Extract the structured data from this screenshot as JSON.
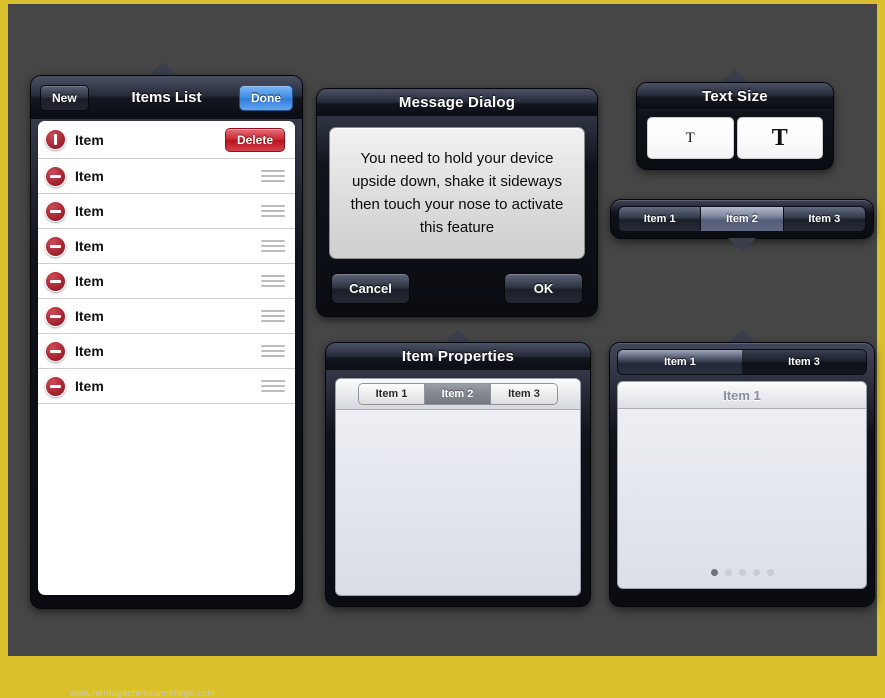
{
  "watermark": "www.heritagechristiancollege.com",
  "colors": {
    "frame": "#d9c02c",
    "canvas_bg": "#464646",
    "accent_blue": "#3f8de5",
    "delete_red": "#cd2430",
    "panel_dark": "#11131b"
  },
  "items_list": {
    "title": "Items List",
    "new_label": "New",
    "done_label": "Done",
    "delete_label": "Delete",
    "rows": [
      {
        "label": "Item",
        "icon": "stop-bar-icon",
        "action": "delete-button"
      },
      {
        "label": "Item",
        "icon": "minus-circle-icon",
        "action": "drag-handle"
      },
      {
        "label": "Item",
        "icon": "minus-circle-icon",
        "action": "drag-handle"
      },
      {
        "label": "Item",
        "icon": "minus-circle-icon",
        "action": "drag-handle"
      },
      {
        "label": "Item",
        "icon": "minus-circle-icon",
        "action": "drag-handle"
      },
      {
        "label": "Item",
        "icon": "minus-circle-icon",
        "action": "drag-handle"
      },
      {
        "label": "Item",
        "icon": "minus-circle-icon",
        "action": "drag-handle"
      },
      {
        "label": "Item",
        "icon": "minus-circle-icon",
        "action": "drag-handle"
      }
    ]
  },
  "message_dialog": {
    "title": "Message Dialog",
    "body": "You need to hold your device upside down, shake it sideways then touch your nose to activate this feature",
    "cancel_label": "Cancel",
    "ok_label": "OK"
  },
  "text_size": {
    "title": "Text Size",
    "small_label": "T",
    "large_label": "T"
  },
  "dark_segmented": {
    "segments": [
      "Item 1",
      "Item 2",
      "Item 3"
    ],
    "selected_index": 1
  },
  "item_properties": {
    "title": "Item Properties",
    "segments": [
      "Item 1",
      "Item 2",
      "Item 3"
    ],
    "selected_index": 1
  },
  "tab_panel": {
    "tabs": [
      "Item 1",
      "Item 3"
    ],
    "selected_index": 0,
    "content_header": "Item 1",
    "page_count": 5,
    "page_active": 0
  }
}
